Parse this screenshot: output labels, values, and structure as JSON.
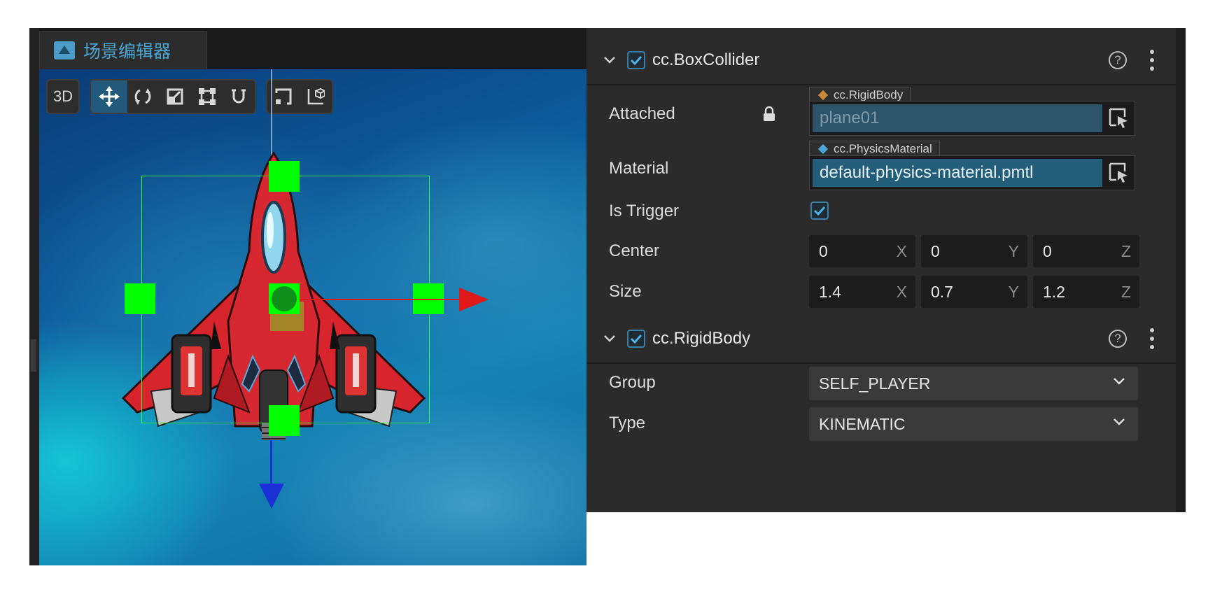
{
  "scene_editor": {
    "tab_title": "场景编辑器",
    "toolbar": {
      "mode_3d": "3D",
      "transform_tools": [
        "move-tool",
        "rotate-tool",
        "scale-tool",
        "rect-tool",
        "snap-tool"
      ],
      "active_tool": "move-tool",
      "view_tools": [
        "pivot-tool",
        "local-global-tool"
      ]
    },
    "gizmo_colors": {
      "x_axis": "#e01818",
      "y_axis": "#1a2fd6",
      "collider": "#00ff00"
    }
  },
  "inspector": {
    "box_collider": {
      "title": "cc.BoxCollider",
      "enabled": true,
      "attached": {
        "label": "Attached",
        "type_tag": "cc.RigidBody",
        "value": "plane01",
        "locked": true
      },
      "material": {
        "label": "Material",
        "type_tag": "cc.PhysicsMaterial",
        "value": "default-physics-material.pmtl"
      },
      "is_trigger": {
        "label": "Is Trigger",
        "checked": true
      },
      "center": {
        "label": "Center",
        "x": "0",
        "y": "0",
        "z": "0"
      },
      "size": {
        "label": "Size",
        "x": "1.4",
        "y": "0.7",
        "z": "1.2"
      },
      "axis_labels": {
        "x": "X",
        "y": "Y",
        "z": "Z"
      },
      "help_glyph": "?"
    },
    "rigid_body": {
      "title": "cc.RigidBody",
      "enabled": true,
      "group": {
        "label": "Group",
        "value": "SELF_PLAYER"
      },
      "type": {
        "label": "Type",
        "value": "KINEMATIC"
      },
      "help_glyph": "?"
    },
    "accent_color": "#3c7ea6"
  }
}
